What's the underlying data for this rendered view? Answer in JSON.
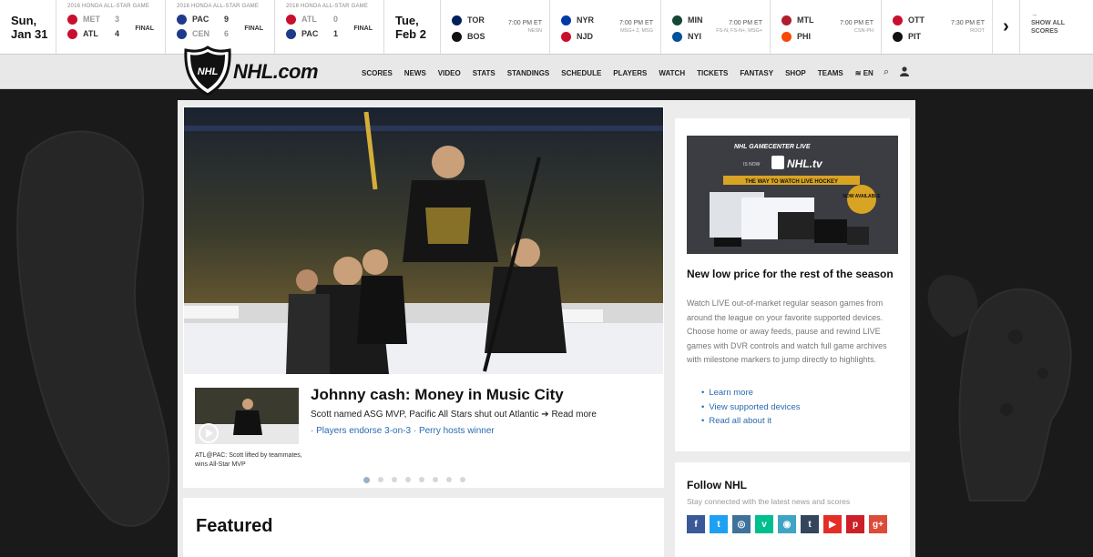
{
  "ticker": {
    "date1_day": "Sun,",
    "date1_date": "Jan 31",
    "games_final": [
      {
        "header": "2016 HONDA ALL-STAR GAME",
        "home": {
          "abbr": "MET",
          "score": "3",
          "color": "#c8102e"
        },
        "away": {
          "abbr": "ATL",
          "score": "4",
          "color": "#c8102e"
        },
        "status": "FINAL"
      },
      {
        "header": "2016 HONDA ALL-STAR GAME",
        "home": {
          "abbr": "PAC",
          "score": "9",
          "color": "#1e3a8a"
        },
        "away": {
          "abbr": "CEN",
          "score": "6",
          "color": "#1e3a8a"
        },
        "status": "FINAL"
      },
      {
        "header": "2016 HONDA ALL-STAR GAME",
        "home": {
          "abbr": "ATL",
          "score": "0",
          "color": "#c8102e"
        },
        "away": {
          "abbr": "PAC",
          "score": "1",
          "color": "#1e3a8a"
        },
        "status": "FINAL"
      }
    ],
    "date2_day": "Tue,",
    "date2_date": "Feb 2",
    "games_sched": [
      {
        "home": {
          "abbr": "TOR",
          "color": "#00205b"
        },
        "away": {
          "abbr": "BOS",
          "color": "#111111"
        },
        "time": "7:00 PM ET",
        "net": "NESN"
      },
      {
        "home": {
          "abbr": "NYR",
          "color": "#0038a8"
        },
        "away": {
          "abbr": "NJD",
          "color": "#c8102e"
        },
        "time": "7:00 PM ET",
        "net": "MSG+ 2, MSG"
      },
      {
        "home": {
          "abbr": "MIN",
          "color": "#154734"
        },
        "away": {
          "abbr": "NYI",
          "color": "#00539b"
        },
        "time": "7:00 PM ET",
        "net": "FS-N, FS-N+, MSG+"
      },
      {
        "home": {
          "abbr": "MTL",
          "color": "#af1e2d"
        },
        "away": {
          "abbr": "PHI",
          "color": "#f74902"
        },
        "time": "7:00 PM ET",
        "net": "CSN-PH"
      },
      {
        "home": {
          "abbr": "OTT",
          "color": "#c8102e"
        },
        "away": {
          "abbr": "PIT",
          "color": "#111111"
        },
        "time": "7:30 PM ET",
        "net": "ROOT"
      }
    ],
    "next_arrow": "›",
    "show_all_arrow": "→",
    "show_all_1": "SHOW ALL",
    "show_all_2": "SCORES"
  },
  "nav": {
    "brand": "NHL.com",
    "items": [
      "SCORES",
      "NEWS",
      "VIDEO",
      "STATS",
      "STANDINGS",
      "SCHEDULE",
      "PLAYERS",
      "WATCH",
      "TICKETS",
      "FANTASY",
      "SHOP",
      "TEAMS",
      "EN"
    ],
    "search_icon": "⌕",
    "user_icon": "👤"
  },
  "hero": {
    "headline": "Johnny cash: Money in Music City",
    "subline": "Scott named ASG MVP, Pacific All Stars shut out Atlantic",
    "read_more": "Read more",
    "link1": "Players endorse 3-on-3",
    "link2": "Perry hosts winner",
    "thumb_caption": "ATL@PAC: Scott lifted by teammates, wins All-Star MVP",
    "dots": 8,
    "active_dot": 0
  },
  "featured": {
    "title": "Featured"
  },
  "ad": {
    "banner_line1": "NHL GAMECENTER LIVE",
    "banner_line2": "IS NOW",
    "banner_brand": "NHL.tv",
    "banner_tag": "THE WAY TO WATCH LIVE HOCKEY",
    "banner_badge": "NOW AVAILABLE",
    "title": "New low price for the rest of the season",
    "body": "Watch LIVE out-of-market regular season games from around the league on your favorite supported devices. Choose home or away feeds, pause and rewind LIVE games with DVR controls and watch full game archives with milestone markers to jump directly to highlights.",
    "links": [
      "Learn more",
      "View supported devices",
      "Read all about it"
    ]
  },
  "follow": {
    "title": "Follow NHL",
    "sub": "Stay connected with the latest news and scores",
    "socials": [
      {
        "name": "facebook-icon",
        "glyph": "f",
        "color": "#3b5998"
      },
      {
        "name": "twitter-icon",
        "glyph": "t",
        "color": "#1da1f2"
      },
      {
        "name": "instagram-icon",
        "glyph": "◎",
        "color": "#3f729b"
      },
      {
        "name": "vine-icon",
        "glyph": "v",
        "color": "#00bf8f"
      },
      {
        "name": "periscope-icon",
        "glyph": "◉",
        "color": "#40a4c4"
      },
      {
        "name": "tumblr-icon",
        "glyph": "t",
        "color": "#35465c"
      },
      {
        "name": "youtube-icon",
        "glyph": "▶",
        "color": "#e52d27"
      },
      {
        "name": "pinterest-icon",
        "glyph": "p",
        "color": "#cb2027"
      },
      {
        "name": "googleplus-icon",
        "glyph": "g+",
        "color": "#dd4b39"
      }
    ]
  }
}
